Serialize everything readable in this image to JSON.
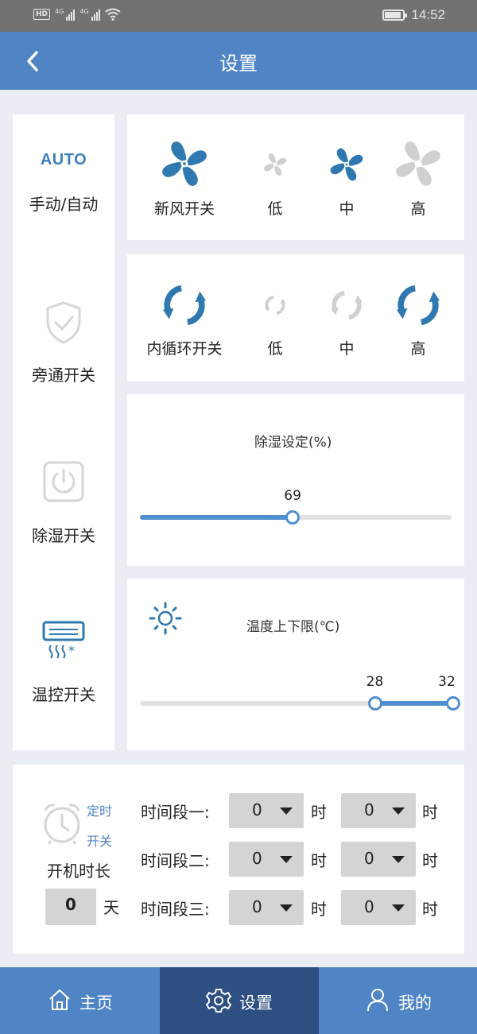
{
  "status_bar": {
    "network_badge": "HD",
    "signal_1": "4G",
    "signal_2": "4G",
    "time": "14:52"
  },
  "header": {
    "title": "设置",
    "back_icon": "chevron-left-icon"
  },
  "mode_panel": {
    "auto_text": "AUTO",
    "manual_auto_label": "手动/自动",
    "bypass_label": "旁通开关",
    "dehumidify_label": "除湿开关",
    "temp_control_label": "温控开关"
  },
  "fresh_air": {
    "switch_label": "新风开关",
    "levels": [
      {
        "label": "低"
      },
      {
        "label": "中"
      },
      {
        "label": "高"
      }
    ],
    "active_level": "中"
  },
  "recirculation": {
    "switch_label": "内循环开关",
    "levels": [
      {
        "label": "低"
      },
      {
        "label": "中"
      },
      {
        "label": "高"
      }
    ],
    "active_level": "高"
  },
  "humidity": {
    "title": "除湿设定(%)",
    "value": "69",
    "value_fraction": 0.49
  },
  "temperature": {
    "title": "温度上下限(℃)",
    "low": "28",
    "high": "32",
    "low_fraction": 0.75,
    "high_fraction": 1.0
  },
  "timer": {
    "timer_label_1": "定时",
    "timer_label_2": "开关",
    "duration_label": "开机时长",
    "days_value": "0",
    "days_unit": "天",
    "periods": [
      {
        "label": "时间段一:",
        "start": "0",
        "end": "0"
      },
      {
        "label": "时间段二:",
        "start": "0",
        "end": "0"
      },
      {
        "label": "时间段三:",
        "start": "0",
        "end": "0"
      }
    ],
    "hour_unit": "时"
  },
  "tabbar": {
    "home": "主页",
    "settings": "设置",
    "mine": "我的",
    "active": "设置"
  },
  "colors": {
    "primary": "#4f85c4",
    "active_tab": "#2e4f82",
    "fan_blue": "#2f78b0",
    "fan_light": "#d0d0d0"
  }
}
